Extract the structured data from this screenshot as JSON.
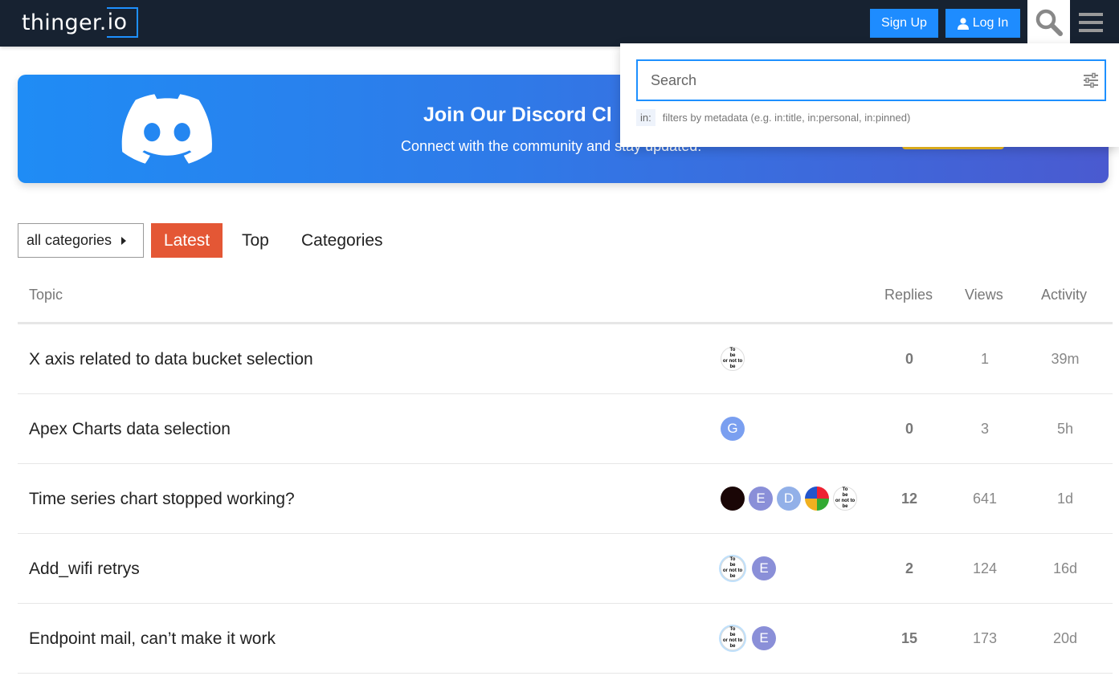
{
  "header": {
    "logo_text": "thinger.",
    "logo_suffix": "io",
    "signup_label": "Sign Up",
    "login_label": "Log In",
    "search_icon": "search-icon",
    "menu_icon": "hamburger-menu-icon"
  },
  "banner": {
    "title": "Join Our Discord Cl",
    "subtitle": "Connect with the community and stay updated.",
    "icon": "discord-logo"
  },
  "search": {
    "placeholder": "Search",
    "value": "",
    "hint_tag": "in:",
    "hint_text": "filters by metadata (e.g. in:title, in:personal, in:pinned)"
  },
  "nav": {
    "category_dropdown": "all categories",
    "tabs": [
      "Latest",
      "Top",
      "Categories"
    ],
    "active_tab": "Latest",
    "active_color": "#e45735"
  },
  "table": {
    "headers": {
      "topic": "Topic",
      "replies": "Replies",
      "views": "Views",
      "activity": "Activity"
    },
    "rows": [
      {
        "title": "X axis related to data bucket selection",
        "replies": "0",
        "views": "1",
        "activity": "39m",
        "posters": [
          "to-be-or-not-to-be-avatar"
        ]
      },
      {
        "title": "Apex Charts data selection",
        "replies": "0",
        "views": "3",
        "activity": "5h",
        "posters": [
          "G"
        ]
      },
      {
        "title": "Time series chart stopped working?",
        "replies": "12",
        "views": "641",
        "activity": "1d",
        "posters": [
          "dark-avatar",
          "E",
          "D",
          "flag-avatar",
          "to-be-or-not-to-be-avatar"
        ]
      },
      {
        "title": "Add_wifi retrys",
        "replies": "2",
        "views": "124",
        "activity": "16d",
        "posters": [
          "to-be-or-not-to-be-avatar",
          "E"
        ]
      },
      {
        "title": "Endpoint mail, can’t make it work",
        "replies": "15",
        "views": "173",
        "activity": "20d",
        "posters": [
          "to-be-or-not-to-be-avatar",
          "E"
        ]
      }
    ]
  },
  "avatar_text": {
    "line1": "To",
    "line2": "be",
    "line3": "or not to",
    "line4": "be",
    "g": "G",
    "e": "E",
    "d": "D"
  },
  "colors": {
    "header_bg": "#172231",
    "primary": "#1e8cff",
    "latest": "#e45735",
    "banner_start": "#1f8cf5",
    "banner_end": "#4a5ad0"
  }
}
